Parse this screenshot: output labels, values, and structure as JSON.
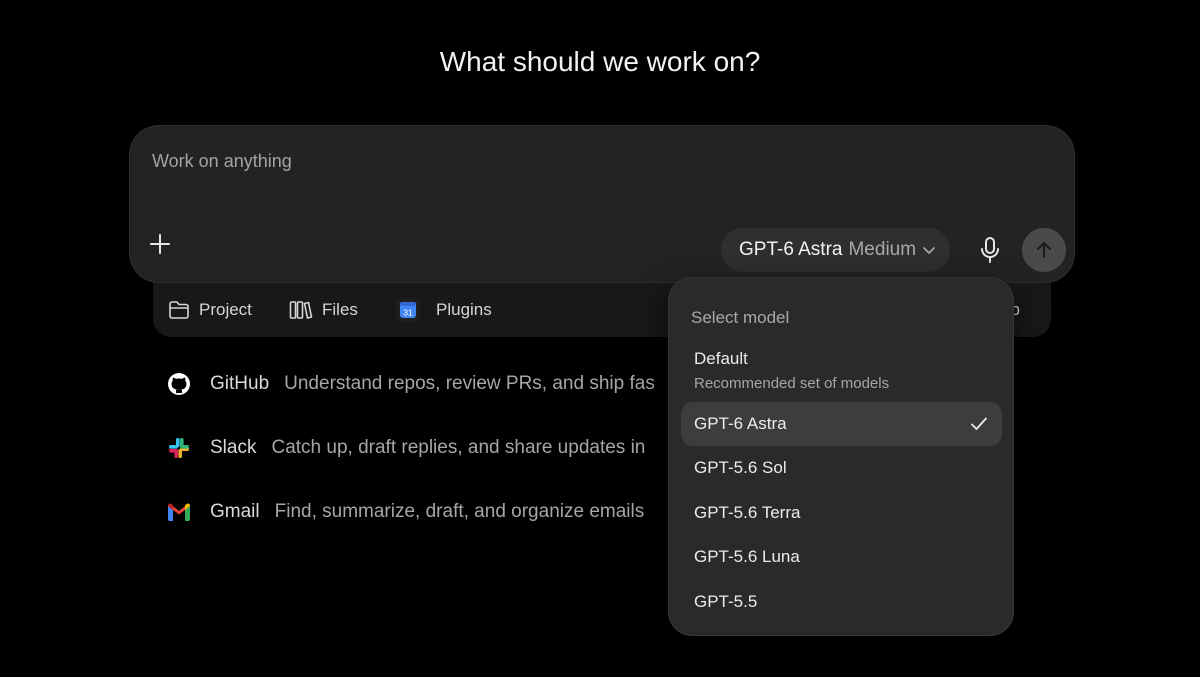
{
  "heading": "What should we work on?",
  "composer": {
    "placeholder": "Work on anything",
    "model_name": "GPT-6 Astra",
    "model_effort": "Medium"
  },
  "toolbar": {
    "project_label": "Project",
    "files_label": "Files",
    "plugins_label": "Plugins",
    "calendar_day": "31",
    "app_label_visible": "pp"
  },
  "suggestions": [
    {
      "icon": "github-icon",
      "title": "GitHub",
      "description": "Understand repos, review PRs, and ship fas"
    },
    {
      "icon": "slack-icon",
      "title": "Slack",
      "description": "Catch up, draft replies, and share updates in"
    },
    {
      "icon": "gmail-icon",
      "title": "Gmail",
      "description": "Find, summarize, draft, and organize emails"
    }
  ],
  "dropdown": {
    "header": "Select model",
    "default_title": "Default",
    "default_subtitle": "Recommended set of models",
    "models": [
      {
        "label": "GPT-6 Astra",
        "selected": true
      },
      {
        "label": "GPT-5.6 Sol",
        "selected": false
      },
      {
        "label": "GPT-5.6 Terra",
        "selected": false
      },
      {
        "label": "GPT-5.6 Luna",
        "selected": false
      },
      {
        "label": "GPT-5.5",
        "selected": false
      }
    ]
  },
  "colors": {
    "background": "#000000",
    "composer_bg": "#232323",
    "dropdown_bg": "#2a2a2a",
    "selected_bg": "#3d3d3d",
    "send_button": "#4a4a4a"
  }
}
